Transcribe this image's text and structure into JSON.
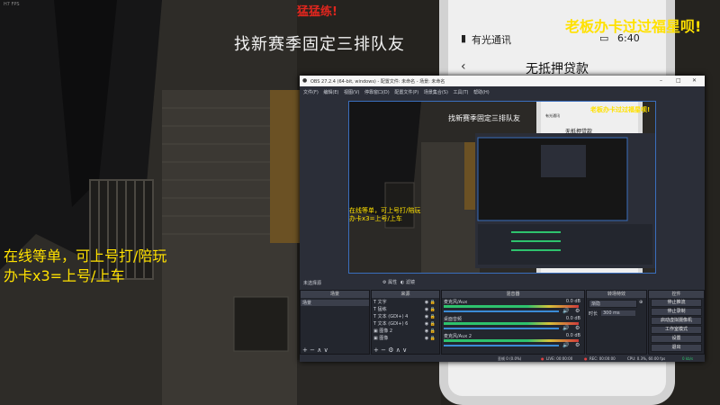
{
  "overlays": {
    "fps": "H7 FPS",
    "top_red": "猛猛练!",
    "team_title": "找新赛季固定三排队友",
    "boss_title": "老板办卡过过福星呗!",
    "left_line1": "在线等单，可上号打/陪玩",
    "left_line2": "办卡x3=上号/上车"
  },
  "phone": {
    "carrier": "有光通讯",
    "time": "6:40",
    "title": "无抵押贷款"
  },
  "obs": {
    "window_title": "OBS 27.2.4 (64-bit, windows) - 配置文件: 未命名 - 场景: 未命名",
    "menu": [
      "文件(F)",
      "编辑(E)",
      "视图(V)",
      "停靠窗口(D)",
      "配置文件(P)",
      "场景集合(S)",
      "工具(T)",
      "帮助(H)"
    ],
    "preview": {
      "team_title": "找新赛季固定三排队友",
      "boss_title": "老板办卡过过福星呗!",
      "left_line1": "在线等单，可上号打/陪玩",
      "left_line2": "办卡x3=上号/上车",
      "phone_title": "无抵押贷款",
      "phone_carrier": "有光通讯"
    },
    "bar": {
      "no_source": "未选择源",
      "props": "属性",
      "filters": "滤镜"
    },
    "scenes": {
      "header": "场景",
      "items": [
        "场景"
      ]
    },
    "sources": {
      "header": "来源",
      "items": [
        "文字",
        "猛练",
        "文本 (GDI+) 4",
        "文本 (GDI+) 6",
        "图像 2",
        "图像"
      ]
    },
    "mixer": {
      "header": "混音器",
      "channels": [
        {
          "name": "麦克风/Aux",
          "db": "0.0 dB"
        },
        {
          "name": "桌面音频",
          "db": "0.0 dB"
        },
        {
          "name": "麦克风/Aux 2",
          "db": "0.0 dB"
        }
      ]
    },
    "transitions": {
      "header": "转场特效",
      "type": "渐隐",
      "duration_label": "时长",
      "duration": "300 ms"
    },
    "controls": {
      "header": "控件",
      "buttons": [
        "停止推流",
        "停止录制",
        "启动虚拟摄像机",
        "工作室模式",
        "设置",
        "退出"
      ]
    },
    "status": {
      "dropped": "丢帧 0 (0.0%)",
      "live": "LIVE: 00:00:00",
      "rec": "REC: 00:00:00",
      "cpu": "CPU: 0.3%, 60.00 fps",
      "kbps": "0 kb/s"
    }
  }
}
